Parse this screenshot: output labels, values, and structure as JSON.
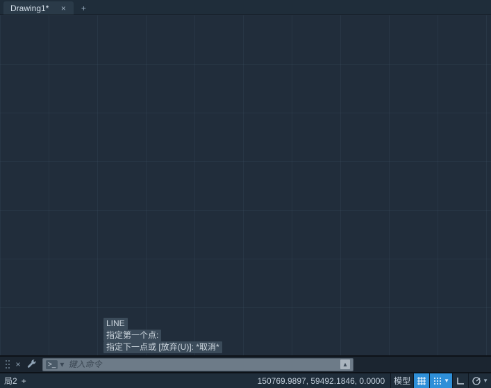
{
  "tabs": {
    "active": {
      "label": "Drawing1*",
      "close": "×"
    },
    "plus": "+"
  },
  "command_history": {
    "line0": "LINE",
    "line1": "指定第一个点:",
    "line2": "指定下一点或 [放弃(U)]: *取消*"
  },
  "command_bar": {
    "close": "×",
    "prompt_icon": ">_",
    "dropdown": "▾",
    "placeholder": "键入命令",
    "up": "▴"
  },
  "status": {
    "layout_tab": "局2",
    "layout_plus": "+",
    "coords": "150769.9897, 59492.1846, 0.0000",
    "buttons": {
      "model": "模型"
    }
  }
}
